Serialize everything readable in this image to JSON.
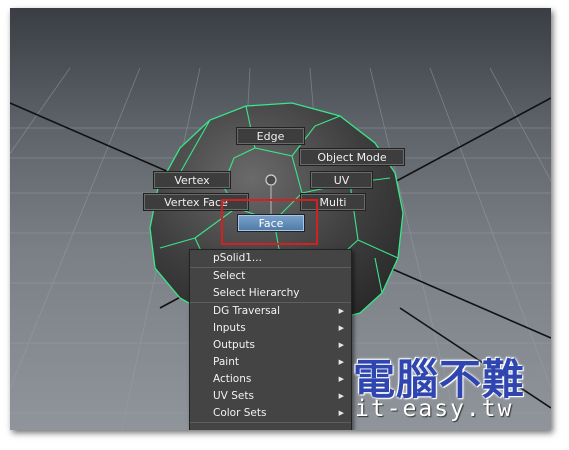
{
  "marking_menu": {
    "edge": "Edge",
    "object_mode": "Object Mode",
    "vertex": "Vertex",
    "uv": "UV",
    "vertex_face": "Vertex Face",
    "multi": "Multi",
    "face": "Face"
  },
  "context_menu": {
    "object_name": "pSolid1...",
    "items": [
      {
        "label": "Select"
      },
      {
        "label": "Select Hierarchy"
      },
      {
        "label": "DG Traversal",
        "submenu": true
      },
      {
        "label": "Inputs",
        "submenu": true
      },
      {
        "label": "Outputs",
        "submenu": true
      },
      {
        "label": "Paint",
        "submenu": true
      },
      {
        "label": "Actions",
        "submenu": true
      },
      {
        "label": "UV Sets",
        "submenu": true
      },
      {
        "label": "Color Sets",
        "submenu": true
      }
    ],
    "arrow_glyph": "▶"
  },
  "watermark": {
    "chinese": "電腦不難",
    "site": "it-easy.tw"
  },
  "colors": {
    "wireframe": "#39e68a",
    "highlight_box": "#d42020",
    "watermark": "#2f45b0"
  }
}
